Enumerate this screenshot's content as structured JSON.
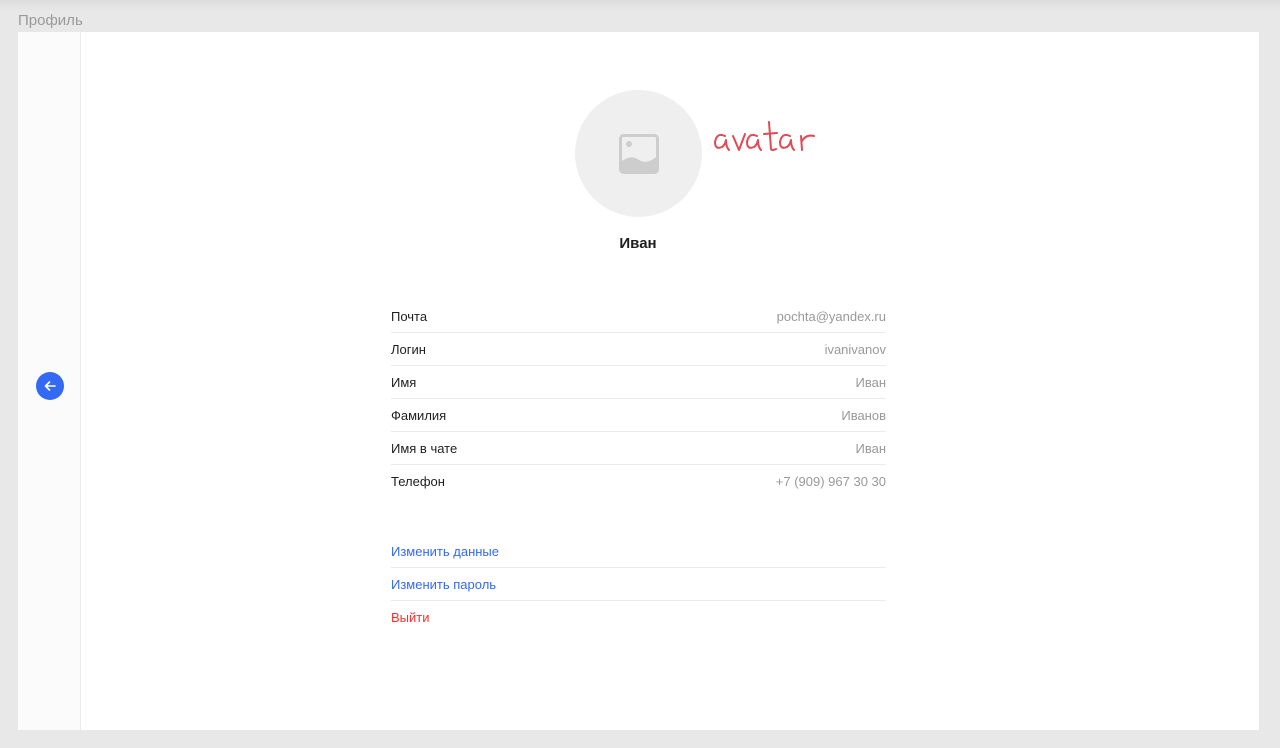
{
  "header": {
    "title": "Профиль"
  },
  "profile": {
    "display_name": "Иван",
    "avatar_note": "avatar"
  },
  "fields": [
    {
      "label": "Почта",
      "value": "pochta@yandex.ru"
    },
    {
      "label": "Логин",
      "value": "ivanivanov"
    },
    {
      "label": "Имя",
      "value": "Иван"
    },
    {
      "label": "Фамилия",
      "value": "Иванов"
    },
    {
      "label": "Имя в чате",
      "value": "Иван"
    },
    {
      "label": "Телефон",
      "value": "+7 (909) 967 30 30"
    }
  ],
  "actions": {
    "edit_data": "Изменить данные",
    "edit_password": "Изменить пароль",
    "logout": "Выйти"
  },
  "icons": {
    "back": "arrow-left-icon",
    "avatar_placeholder": "image-placeholder-icon"
  },
  "colors": {
    "accent": "#3369f3",
    "danger": "#ff2f2f",
    "annotation": "#e04a55"
  }
}
